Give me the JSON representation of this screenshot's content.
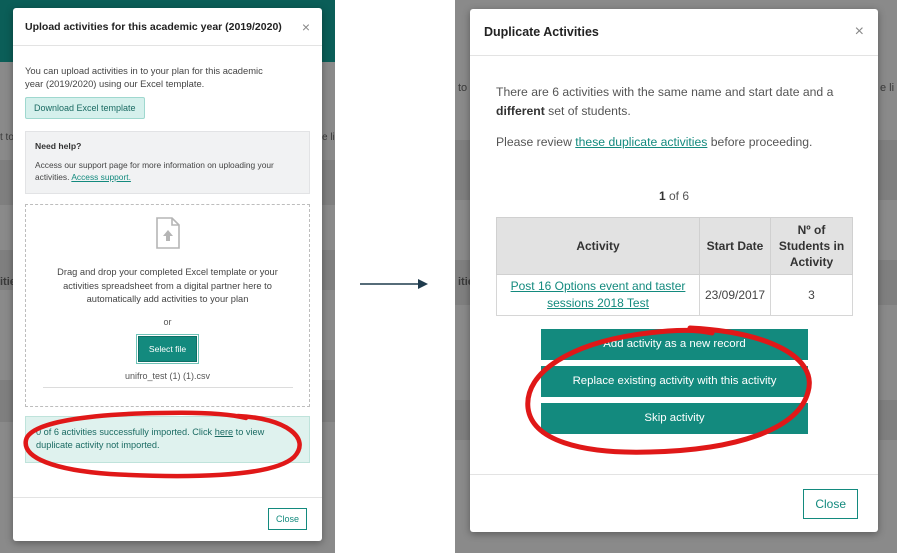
{
  "left_modal": {
    "title": "Upload activities for this academic year (2019/2020)",
    "close_glyph": "×",
    "intro": "You can upload activities in to your plan for this academic year (2019/2020) using our Excel template.",
    "download_button": "Download Excel template",
    "help": {
      "title": "Need help?",
      "text": "Access our support page for more information on uploading your activities.",
      "link": "Access support."
    },
    "drop": {
      "text": "Drag and drop your completed Excel template or your activities spreadsheet from a digital partner here to automatically add activities to your plan",
      "or": "or",
      "select_button": "Select file",
      "file_name": "unifro_test (1) (1).csv"
    },
    "result": {
      "text_before": "0 of 6 activities successfully imported. Click ",
      "link": "here",
      "text_after": " to view duplicate activity not imported."
    },
    "close_button": "Close"
  },
  "right_modal": {
    "title": "Duplicate Activities",
    "close_glyph": "×",
    "message_before": "There are 6 activities with the same name and start date and a ",
    "message_bold": "different",
    "message_after": " set of students.",
    "review_before": "Please review ",
    "review_link": "these duplicate activities",
    "review_after": " before proceeding.",
    "pager_current": "1",
    "pager_rest": " of 6",
    "table": {
      "headers": [
        "Activity",
        "Start Date",
        "Nº of Students in Activity"
      ],
      "row": {
        "activity": "Post 16 Options event and taster sessions 2018 Test",
        "start_date": "23/09/2017",
        "students": "3"
      }
    },
    "actions": {
      "add": "Add activity as a new record",
      "replace": "Replace existing activity with this activity",
      "skip": "Skip activity"
    },
    "close_button": "Close"
  },
  "background": {
    "left_frag_1": "t to",
    "left_frag_2": "itie",
    "left_frag_3": "e li",
    "right_frag_1": "to",
    "right_frag_2": "itie",
    "right_frag_3": "e li"
  },
  "colors": {
    "teal": "#138a7e",
    "dark_teal": "#0b5e58",
    "annotation_red": "#e01818"
  }
}
